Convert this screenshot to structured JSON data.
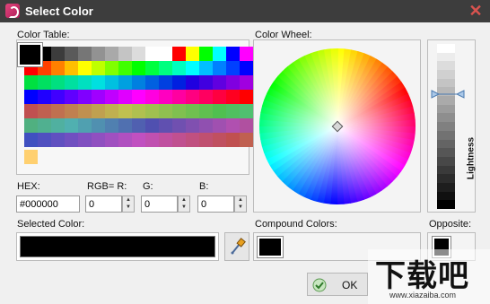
{
  "window": {
    "title": "Select Color",
    "close_glyph": "✕"
  },
  "color_table": {
    "label": "Color Table:",
    "selected_color": "#000000",
    "rows": [
      [
        "#000000",
        "#000000",
        "#3c3c3c",
        "#5a5a5a",
        "#767676",
        "#929292",
        "#a9a9a9",
        "#c4c4c4",
        "#dcdcdc",
        "#ffffff",
        "#ffffff",
        "#ff0000",
        "#ffff00",
        "#00ff00",
        "#00ffff",
        "#0000ff",
        "#ff00ff"
      ],
      [
        "#ff0000",
        "#ff4000",
        "#ff8000",
        "#ffbf00",
        "#ffff00",
        "#bfff00",
        "#80ff00",
        "#40ff00",
        "#00ff00",
        "#00ff40",
        "#00ff80",
        "#00ffbf",
        "#00ffff",
        "#00bfff",
        "#0080ff",
        "#0040ff",
        "#0000ff"
      ],
      [
        "#00e040",
        "#00e060",
        "#00e080",
        "#00e0a0",
        "#00e0c0",
        "#00e0e0",
        "#00c0e0",
        "#00a0e0",
        "#0080e0",
        "#0060e0",
        "#0040e0",
        "#0020e0",
        "#2000e0",
        "#4000e0",
        "#6000e0",
        "#8000e0",
        "#a000e0"
      ],
      [
        "#0000ff",
        "#2000ff",
        "#4000ff",
        "#6000ff",
        "#8000ff",
        "#a000ff",
        "#c000ff",
        "#e000ff",
        "#ff00ff",
        "#ff00e0",
        "#ff00c0",
        "#ff00a0",
        "#ff0080",
        "#ff0060",
        "#ff0040",
        "#ff0020",
        "#ff0000"
      ],
      [
        "#c05050",
        "#c06050",
        "#c07050",
        "#c08050",
        "#c09050",
        "#c0a050",
        "#c0b050",
        "#c0c050",
        "#b0c050",
        "#a0c050",
        "#90c050",
        "#80c050",
        "#70c050",
        "#60c050",
        "#50c050",
        "#50c060",
        "#50c070"
      ],
      [
        "#50b080",
        "#50b090",
        "#50b0a0",
        "#50b0b0",
        "#50a0b0",
        "#5090b0",
        "#5080b0",
        "#5070b0",
        "#5060b0",
        "#5050b0",
        "#6050b0",
        "#7050b0",
        "#8050b0",
        "#9050b0",
        "#a050b0",
        "#b050b0",
        "#b050a0"
      ],
      [
        "#4050c0",
        "#5050c0",
        "#6050c0",
        "#7050c0",
        "#8050c0",
        "#9050c0",
        "#a050c0",
        "#b050c0",
        "#c050c0",
        "#c050b0",
        "#c050a0",
        "#c05090",
        "#c05080",
        "#c05070",
        "#c05060",
        "#c05050",
        "#c06050"
      ]
    ],
    "custom": [
      "#ffd070"
    ]
  },
  "color_wheel": {
    "label": "Color Wheel:"
  },
  "lightness": {
    "label": "Lightness",
    "levels": [
      "#ffffff",
      "#ececec",
      "#dcdcdc",
      "#d0d0d0",
      "#c4c4c4",
      "#b8b8b8",
      "#aaaaaa",
      "#9c9c9c",
      "#8e8e8e",
      "#808080",
      "#727272",
      "#646464",
      "#565656",
      "#484848",
      "#3a3a3a",
      "#2c2c2c",
      "#1e1e1e",
      "#101010",
      "#000000"
    ],
    "level_fraction": 0.3
  },
  "hex": {
    "label": "HEX:",
    "value": "#000000"
  },
  "rgb": {
    "label_r": "RGB= R:",
    "r": "0",
    "label_g": "G:",
    "g": "0",
    "label_b": "B:",
    "b": "0"
  },
  "selected_color": {
    "label": "Selected Color:",
    "color": "#000000"
  },
  "compound_colors": {
    "label": "Compound Colors:",
    "color": "#000000"
  },
  "opposite": {
    "label": "Opposite:",
    "color": "#000000"
  },
  "ok_button": {
    "label": "OK"
  },
  "watermark": {
    "text": "下载吧",
    "url": "www.xiazaiba.com"
  }
}
